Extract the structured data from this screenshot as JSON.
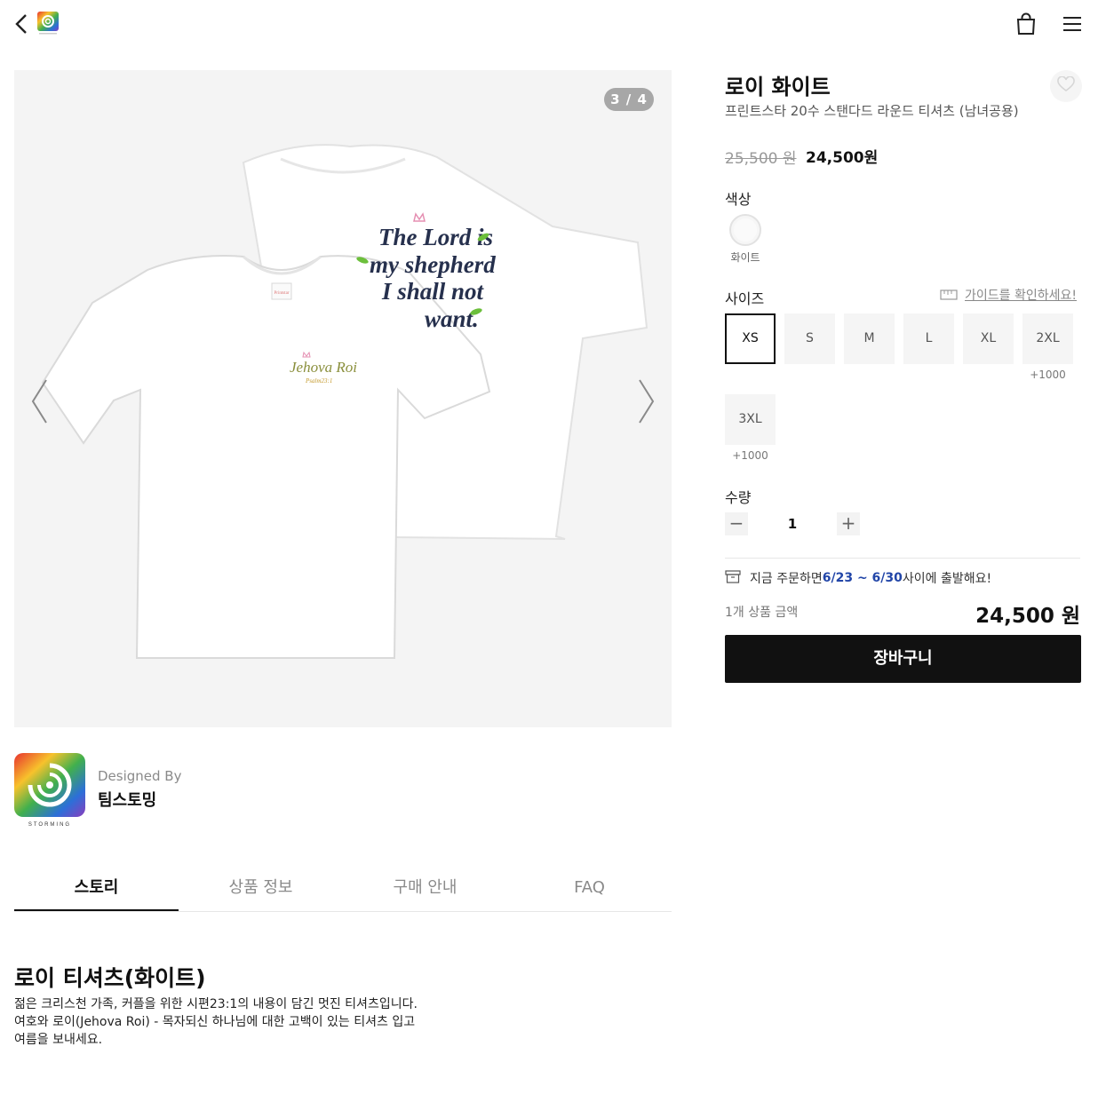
{
  "header": {
    "back_icon": "chevron-left-icon",
    "logo_icon": "swirl-logo-icon",
    "cart_icon": "shopping-bag-icon",
    "menu_icon": "hamburger-menu-icon"
  },
  "gallery": {
    "counter": "3 / 4",
    "prev_icon": "chevron-left-icon",
    "next_icon": "chevron-right-icon",
    "shirt_back_print": [
      "The Lord is",
      "my shepherd",
      "I shall not",
      "want."
    ],
    "shirt_front_print": [
      "Jehova Roi",
      "Psalm23:1"
    ],
    "shirt_tag": "Printstar"
  },
  "designer": {
    "caption": "Designed By",
    "name": "팀스토밍",
    "avatar_text": "STORMING"
  },
  "tabs": [
    {
      "label": "스토리",
      "active": true
    },
    {
      "label": "상품 정보",
      "active": false
    },
    {
      "label": "구매 안내",
      "active": false
    },
    {
      "label": "FAQ",
      "active": false
    }
  ],
  "story": {
    "title": "로이 티셔츠(화이트)",
    "lines": [
      "젊은 크리스천 가족, 커플을 위한 시편23:1의 내용이 담긴 멋진 티셔츠입니다.",
      "여호와 로이(Jehova Roi) - 목자되신 하나님에 대한 고백이 있는 티셔츠 입고 여름을 보내세요."
    ]
  },
  "product": {
    "name": "로이 화이트",
    "subtitle": "프린트스타 20수 스탠다드 라운드 티셔츠 (남녀공용)",
    "price_original": "25,500 원",
    "price_sale": "24,500원",
    "wish_icon": "heart-icon"
  },
  "options": {
    "color_label": "색상",
    "colors": [
      {
        "name": "화이트",
        "hex": "#fafafa",
        "selected": true
      }
    ],
    "size_label": "사이즈",
    "size_guide": "가이드를 확인하세요!",
    "size_guide_icon": "ruler-icon",
    "sizes": [
      {
        "label": "XS",
        "extra": "",
        "selected": true
      },
      {
        "label": "S",
        "extra": "",
        "selected": false
      },
      {
        "label": "M",
        "extra": "",
        "selected": false
      },
      {
        "label": "L",
        "extra": "",
        "selected": false
      },
      {
        "label": "XL",
        "extra": "",
        "selected": false
      },
      {
        "label": "2XL",
        "extra": "+1000",
        "selected": false
      },
      {
        "label": "3XL",
        "extra": "+1000",
        "selected": false
      }
    ],
    "qty_label": "수량",
    "qty": "1",
    "minus_symbol": "−",
    "plus_symbol": "+"
  },
  "shipping": {
    "icon": "box-icon",
    "prefix": "지금 주문하면 ",
    "dates": "6/23 ~ 6/30",
    "suffix": " 사이에 출발해요!"
  },
  "total": {
    "label": "1개 상품 금액",
    "value": "24,500 원"
  },
  "cart_button": "장바구니",
  "colors": {
    "accent_dark": "#111111",
    "ship_date": "#2246a8",
    "muted": "#8a8a8a"
  }
}
